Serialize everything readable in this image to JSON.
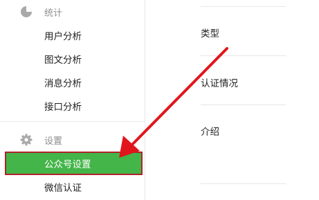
{
  "sidebar": {
    "stats_section": {
      "label": "统计",
      "icon": "pie-chart-icon"
    },
    "stats_items": [
      {
        "label": "用户分析"
      },
      {
        "label": "图文分析"
      },
      {
        "label": "消息分析"
      },
      {
        "label": "接口分析"
      }
    ],
    "settings_section": {
      "label": "设置",
      "icon": "gear-icon"
    },
    "settings_items": [
      {
        "label": "公众号设置",
        "active": true
      },
      {
        "label": "微信认证",
        "active": false
      }
    ]
  },
  "main": {
    "fields": [
      {
        "label": "类型"
      },
      {
        "label": "认证情况"
      },
      {
        "label": "介绍"
      }
    ]
  },
  "annotation": {
    "arrow_color": "#e0161c"
  },
  "colors": {
    "active_bg": "#44b549",
    "active_border": "#b0222a",
    "divider": "#e7e7eb",
    "muted_text": "#8d8d8d"
  }
}
